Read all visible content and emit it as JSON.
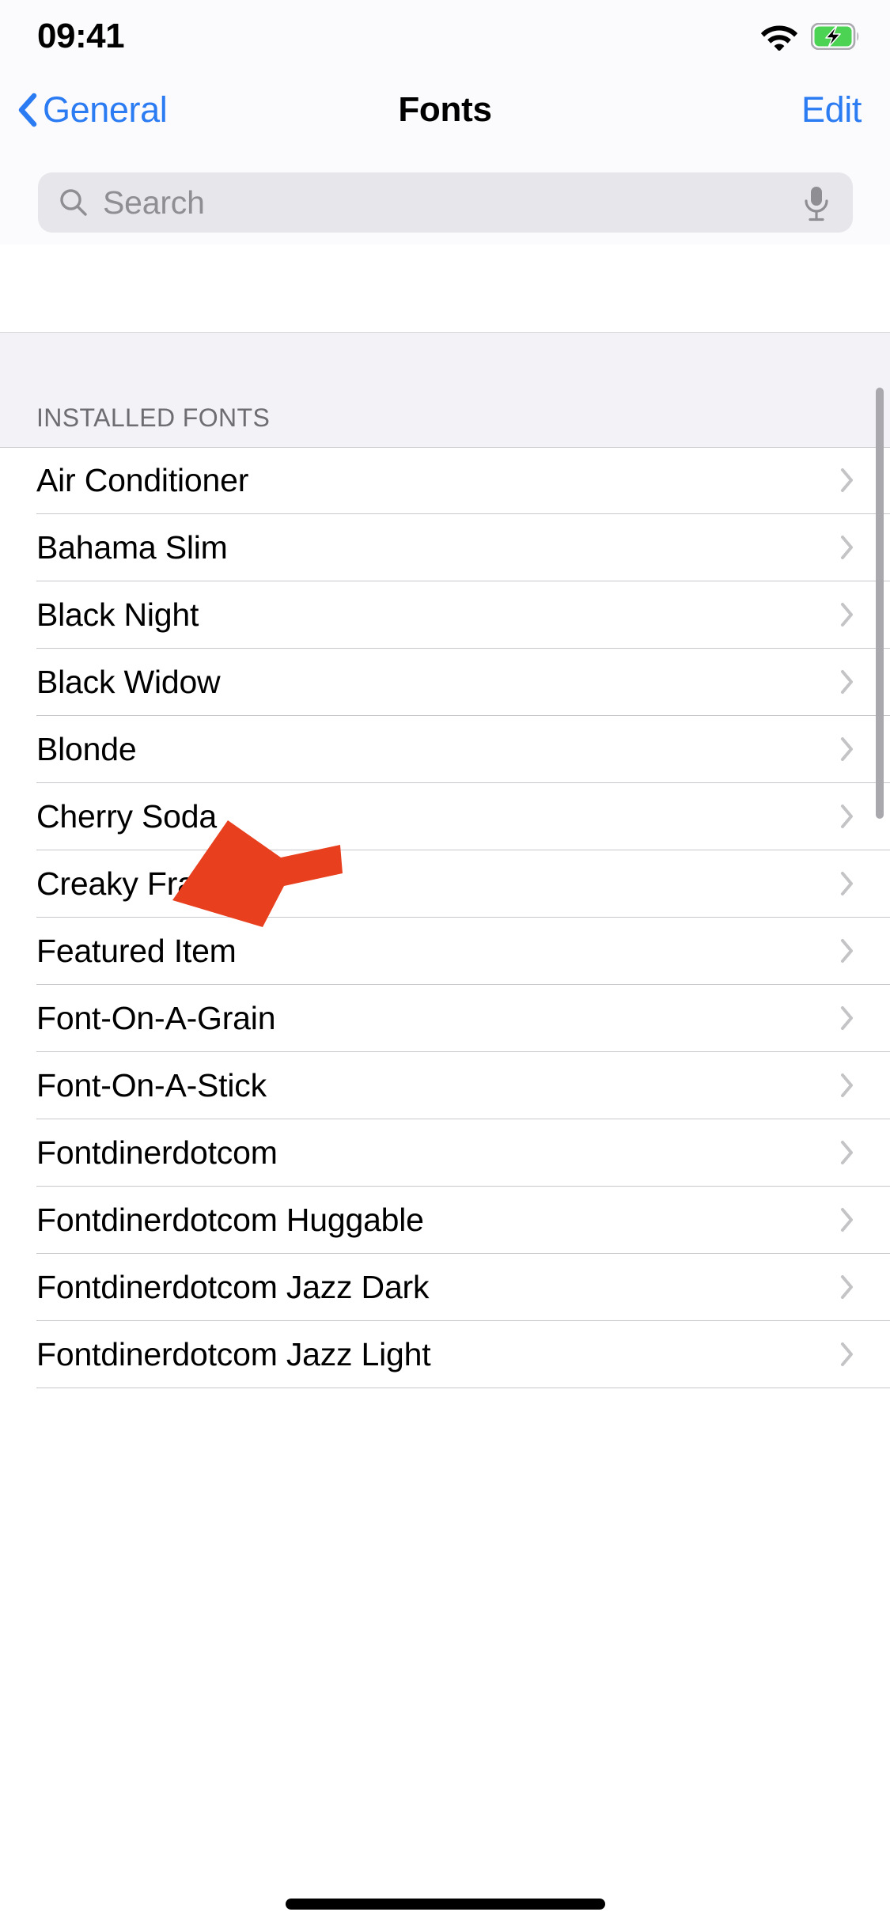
{
  "status_bar": {
    "time": "09:41",
    "wifi_icon": "wifi-icon",
    "battery_icon": "battery-charging-icon",
    "battery_color": "#4cd353"
  },
  "nav_bar": {
    "back_label": "General",
    "back_icon": "chevron-left-icon",
    "title": "Fonts",
    "edit_label": "Edit",
    "accent_color": "#2b7bf3"
  },
  "search": {
    "placeholder": "Search",
    "value": "",
    "search_icon": "search-icon",
    "mic_icon": "microphone-icon",
    "field_color": "#e6e6eb"
  },
  "section": {
    "header": "INSTALLED FONTS",
    "header_bg": "#f2f2f7"
  },
  "list": {
    "chevron_icon": "chevron-right-icon",
    "rows": [
      {
        "label": "Air Conditioner"
      },
      {
        "label": "Bahama Slim"
      },
      {
        "label": "Black Night"
      },
      {
        "label": "Black Widow"
      },
      {
        "label": "Blonde"
      },
      {
        "label": "Cherry Soda"
      },
      {
        "label": "Creaky Frank"
      },
      {
        "label": "Featured Item"
      },
      {
        "label": "Font-On-A-Grain"
      },
      {
        "label": "Font-On-A-Stick"
      },
      {
        "label": "Fontdinerdotcom"
      },
      {
        "label": "Fontdinerdotcom Huggable"
      },
      {
        "label": "Fontdinerdotcom Jazz Dark"
      },
      {
        "label": "Fontdinerdotcom Jazz Light"
      }
    ]
  },
  "annotation": {
    "arrow_icon": "red-arrow-annotation",
    "arrow_color": "#e8401f",
    "points_at": "Blonde"
  },
  "home_indicator": {
    "label": "home-indicator"
  }
}
